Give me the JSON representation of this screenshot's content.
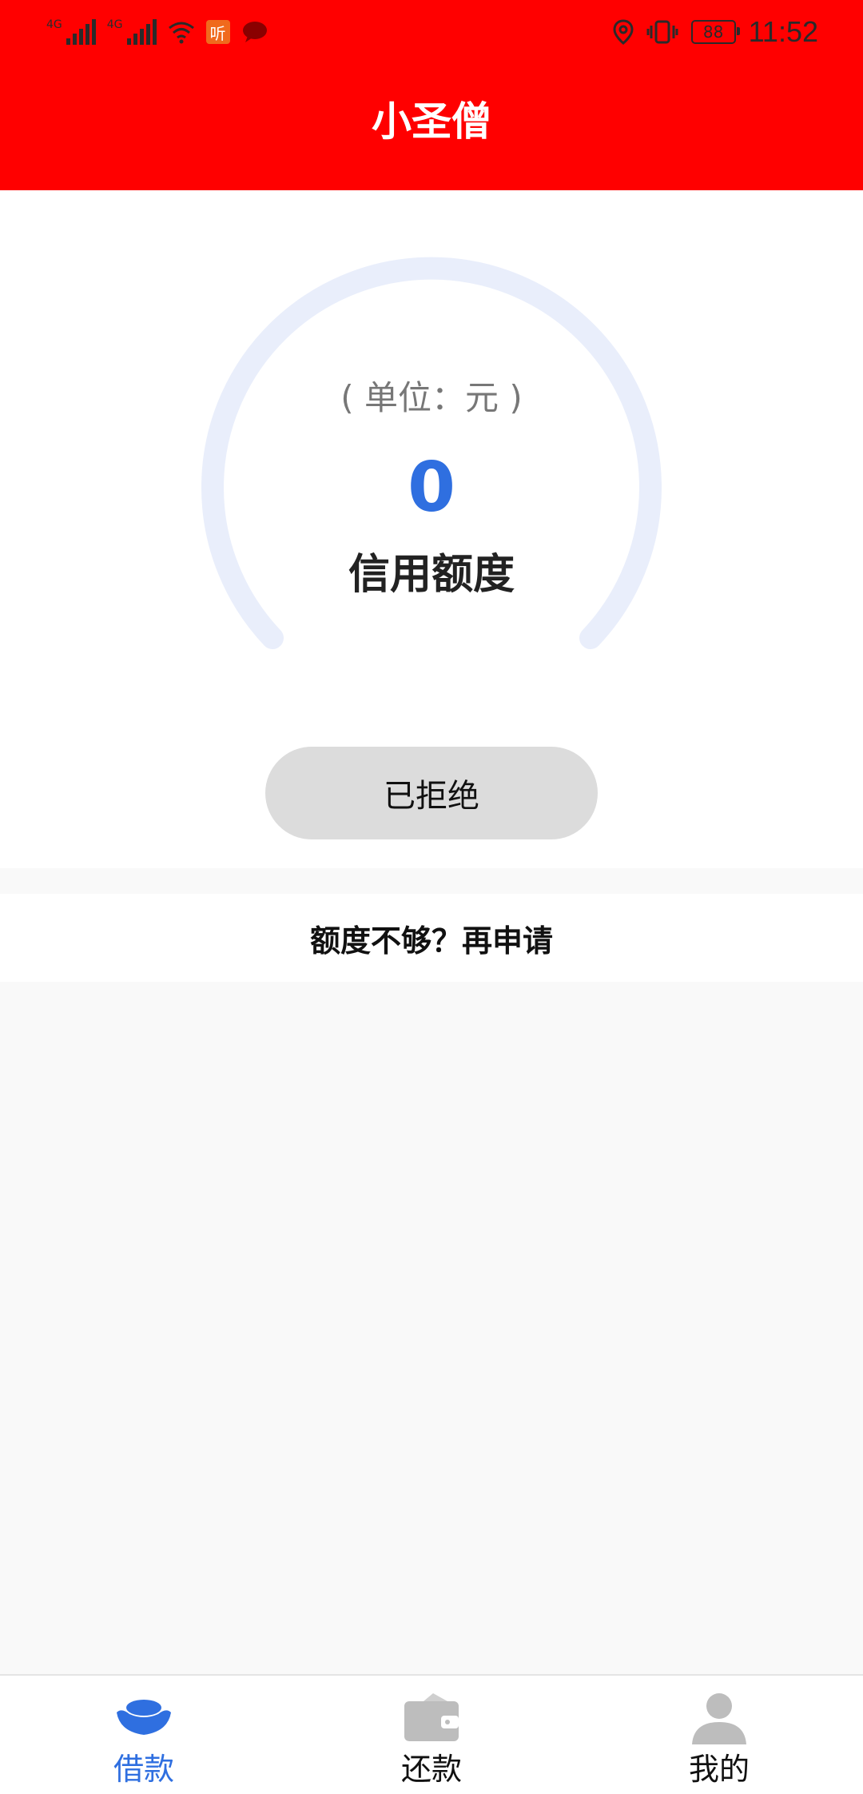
{
  "status_bar": {
    "network_1": "4G",
    "network_2": "4G",
    "ting_badge": "听",
    "battery_level": "88",
    "time": "11:52",
    "icons": [
      "signal-icon",
      "wifi-icon",
      "ting-app-icon",
      "message-icon",
      "location-icon",
      "vibrate-icon",
      "battery-icon"
    ]
  },
  "header": {
    "title": "小圣僧"
  },
  "credit": {
    "unit": "( 单位：元 )",
    "amount": "0",
    "label": "信用额度",
    "status_button": "已拒绝"
  },
  "reapply": {
    "text": "额度不够？再申请"
  },
  "bottom_nav": {
    "items": [
      {
        "label": "借款",
        "icon": "ingot-icon",
        "active": true
      },
      {
        "label": "还款",
        "icon": "wallet-icon",
        "active": false
      },
      {
        "label": "我的",
        "icon": "user-icon",
        "active": false
      }
    ]
  },
  "colors": {
    "header_bg": "#ff0000",
    "accent": "#2f6fe0",
    "gauge_track": "#e9eefb",
    "button_bg": "#dcdcdc",
    "inactive_icon": "#bdbdbd"
  }
}
